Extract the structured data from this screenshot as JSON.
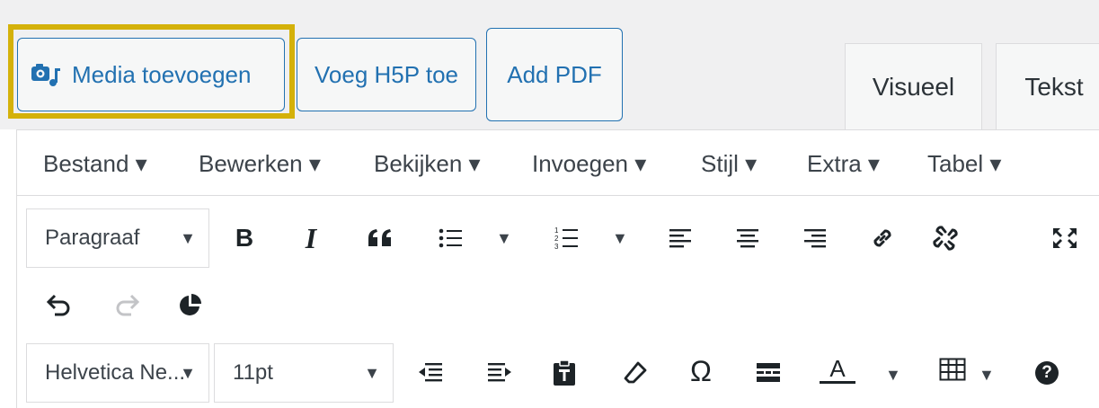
{
  "toolbar_top": {
    "media_button": "Media toevoegen",
    "h5p_button": "Voeg H5P toe",
    "pdf_button": "Add PDF"
  },
  "tabs": {
    "visual": "Visueel",
    "text": "Tekst"
  },
  "menubar": {
    "items": [
      "Bestand ▾",
      "Bewerken ▾",
      "Bekijken ▾",
      "Invoegen ▾",
      "Stijl ▾",
      "Extra ▾",
      "Tabel ▾"
    ]
  },
  "format": {
    "block_format_value": "Paragraaf",
    "font_family_value": "Helvetica Ne...",
    "font_size_value": "11pt",
    "bold": "B",
    "italic": "I",
    "omega": "Ω",
    "text_color_letter": "A",
    "help": "?"
  },
  "colors": {
    "accent": "#2271b1",
    "highlight": "#d4b10a",
    "bar_bg": "#f0f0f1",
    "text_color_underline": "#1d2327"
  },
  "icons": [
    "media-icon",
    "bold-icon",
    "italic-icon",
    "blockquote-icon",
    "bullet-list-icon",
    "numbered-list-icon",
    "align-left-icon",
    "align-center-icon",
    "align-right-icon",
    "link-icon",
    "unlink-icon",
    "fullscreen-icon",
    "undo-icon",
    "redo-icon",
    "pie-chart-icon",
    "outdent-icon",
    "indent-icon",
    "paste-icon",
    "eraser-icon",
    "special-char-icon",
    "page-break-icon",
    "text-color-icon",
    "table-icon",
    "help-icon"
  ]
}
